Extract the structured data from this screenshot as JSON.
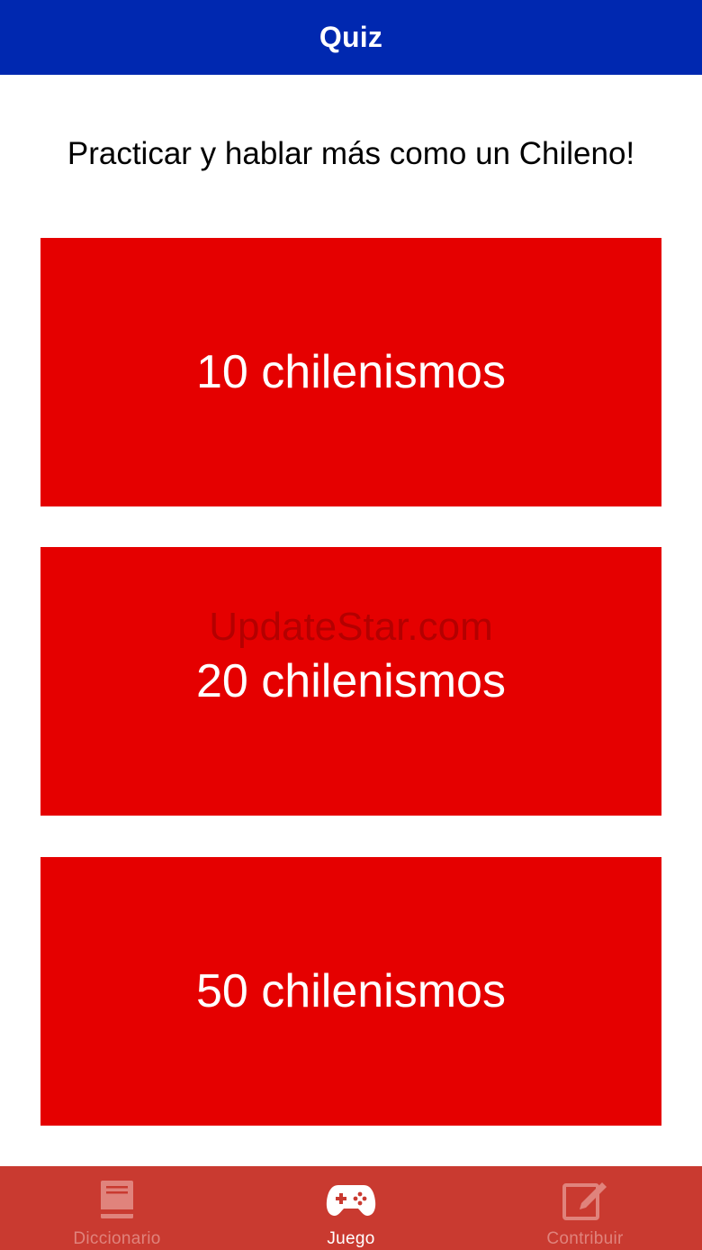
{
  "nav": {
    "title": "Quiz"
  },
  "main": {
    "subtitle": "Practicar y hablar más como un Chileno!",
    "buttons": [
      {
        "label": "10 chilenismos"
      },
      {
        "label": "20 chilenismos"
      },
      {
        "label": "50 chilenismos"
      }
    ],
    "watermark": "UpdateStar.com"
  },
  "tabbar": {
    "items": [
      {
        "label": "Diccionario",
        "icon": "book-icon",
        "active": false
      },
      {
        "label": "Juego",
        "icon": "gamepad-icon",
        "active": true
      },
      {
        "label": "Contribuir",
        "icon": "compose-icon",
        "active": false
      }
    ]
  },
  "colors": {
    "nav_background": "#0028b0",
    "button_background": "#e50000",
    "tabbar_background": "#c93a30",
    "tab_inactive": "#e0837c",
    "tab_active": "#ffffff"
  }
}
